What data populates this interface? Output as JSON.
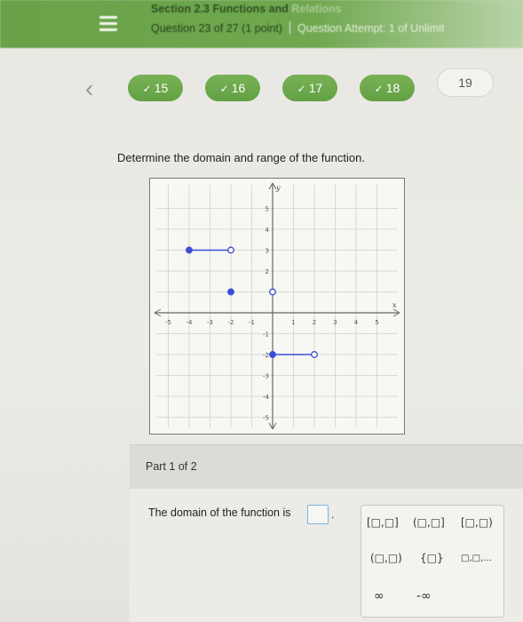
{
  "header": {
    "section_title": "Section 2.3 Functions and",
    "section_title_faded": "Relations",
    "question_label": "Question 23 of 27 (1 point)",
    "attempt_label": "Question Attempt: 1 of Unlimit"
  },
  "nav": {
    "questions": [
      {
        "label": "15",
        "done": true
      },
      {
        "label": "16",
        "done": true
      },
      {
        "label": "17",
        "done": true
      },
      {
        "label": "18",
        "done": true
      },
      {
        "label": "19",
        "done": false
      }
    ],
    "check_glyph": "✓"
  },
  "instruction": "Determine the domain and range of the function.",
  "chart_data": {
    "type": "scatter",
    "x_axis_label": "x",
    "y_axis_label": "y",
    "xlim": [
      -5,
      5
    ],
    "ylim": [
      -5,
      5
    ],
    "grid": true,
    "x_tick_labels": [
      "-5",
      "-4",
      "-3",
      "-2",
      "-1",
      "1",
      "2",
      "3",
      "4",
      "5"
    ],
    "y_tick_labels": [
      "5",
      "4",
      "3",
      "2",
      "-1",
      "-2",
      "-3",
      "-4",
      "-5"
    ],
    "segments": [
      {
        "x1": -4,
        "y1": 3,
        "x2": -2,
        "y2": 3,
        "start": "closed",
        "end": "open"
      },
      {
        "x1": 0,
        "y1": -2,
        "x2": 2,
        "y2": -2,
        "start": "closed",
        "end": "open"
      }
    ],
    "points": [
      {
        "x": -2,
        "y": 1,
        "style": "closed"
      },
      {
        "x": 0,
        "y": 1,
        "style": "open"
      }
    ]
  },
  "part": {
    "label": "Part 1 of 2",
    "prompt": "The domain of the function is",
    "period": "."
  },
  "palette": {
    "row1": [
      "[□,□]",
      "(□,□]",
      "[□,□)"
    ],
    "row2": [
      "(□,□)",
      "{□}",
      "□,□,..."
    ],
    "row3": [
      "∞",
      "-∞"
    ]
  },
  "colors": {
    "header_green": "#6aa24a",
    "pill_green": "#6fa84f",
    "graph_blue": "#3b4fd6",
    "input_border": "#7fb3d6"
  }
}
